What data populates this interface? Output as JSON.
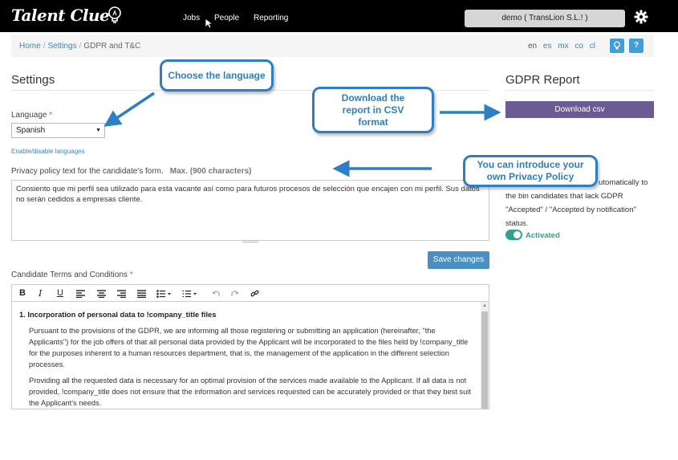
{
  "nav": {
    "logo": "Talent Clue",
    "items": [
      "Jobs",
      "People",
      "Reporting"
    ],
    "company": "demo ( TransLion S.L.! )"
  },
  "breadcrumb": {
    "home": "Home",
    "settings": "Settings",
    "current": "GDPR and T&C",
    "sep": "/",
    "languages": [
      "en",
      "es",
      "mx",
      "co",
      "cl"
    ],
    "help_label": "?"
  },
  "settings": {
    "heading": "Settings",
    "language_label": "Language",
    "required_mark": "*",
    "language_value": "Spanish",
    "enable_link": "Enable/disable languages",
    "privacy_label": "Privacy policy text for the candidate's form.",
    "privacy_max": "Max. (900 characters)",
    "privacy_text": "Consiento que mi perfil sea utilizado para esta vacante así como para futuros procesos de selección que encajen con mi perfil. Sus datos no serán cedidos a empresas cliente.",
    "save_label": "Save changes",
    "terms_label": "Candidate Terms and Conditions"
  },
  "editor": {
    "item_number": "1.",
    "item_title": "Incorporation of personal data to !company_title files",
    "paragraph1": "Pursuant to the provisions of the GDPR, we are informing all those registering or submitting an application (hereinafter, \"the Applicants\") for the job offers of that all personal data provided by the Applicant will be incorporated to the files held by !company_title for the purposes inherent to a human resources department, that is, the management of the application in the different selection processes.",
    "paragraph2": "Providing all the requested data is necessary for an optimal provision of the services made available to the Applicant. If all data is not provided, !company_title does not ensure that the information and services requested can be accurately provided or that they best suit the Applicant's needs."
  },
  "gdpr": {
    "heading": "GDPR Report",
    "download_label": "Download csv",
    "auto_text_line1": "utomatically to",
    "auto_text_line2": "the bin candidates that lack GDPR",
    "auto_text_line3": "\"Accepted\" / \"Accepted by notification\"",
    "auto_text_line4": "status.",
    "toggle_state": "Activated"
  },
  "callouts": {
    "language": "Choose the language",
    "download": "Download the report in CSV format",
    "privacy": "You can introduce your own Privacy Policy"
  },
  "colors": {
    "topbar": "#000000",
    "accent_blue": "#2d7ec6",
    "download_purple": "#6b5b95",
    "toggle_green": "#2ea58a",
    "save_blue": "#4a8fc2"
  }
}
